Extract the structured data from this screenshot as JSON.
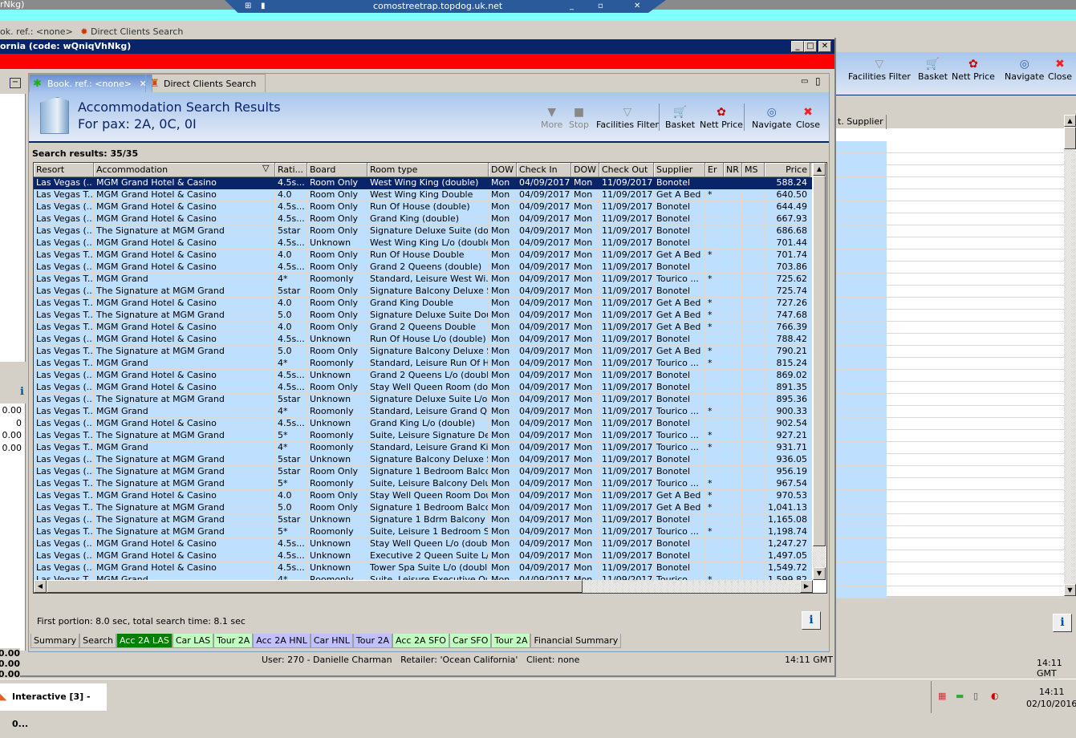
{
  "remote_bar": {
    "host": "comostreetrap.topdog.uk.net",
    "top_left_fragment": "rNkg)"
  },
  "bg_tabs": [
    "ok. ref.: <none>",
    "Direct Clients Search"
  ],
  "bg_toolbar": [
    "Facilities Filter",
    "Basket",
    "Nett Price",
    "Navigate",
    "Close"
  ],
  "bg_table": {
    "header": "t. Supplier",
    "time": "14:11 GMT"
  },
  "window": {
    "title": "ornia (code: wQniqVhNkg)"
  },
  "left_panel": {
    "values": [
      "0.00",
      "0",
      "0.00",
      "0.00"
    ],
    "bottom_values": [
      "0.00",
      "0.00",
      "0.00"
    ]
  },
  "tabs": [
    {
      "label": "Book. ref.: <none>"
    },
    {
      "label": "Direct Clients Search"
    }
  ],
  "header": {
    "title": "Accommodation Search Results",
    "subtitle": "For pax: 2A, 0C, 0I"
  },
  "toolbar": {
    "more": "More",
    "stop": "Stop",
    "facilities": "Facilities Filter",
    "basket": "Basket",
    "nett": "Nett Price",
    "navigate": "Navigate",
    "close": "Close"
  },
  "results_label": "Search results: 35/35",
  "columns": [
    "Resort",
    "Accommodation",
    "Rati...",
    "Board",
    "Room type",
    "DOW",
    "Check In",
    "DOW",
    "Check Out",
    "Supplier",
    "Er",
    "NR",
    "MS",
    "Price"
  ],
  "rows": [
    [
      "Las Vegas (...",
      "MGM Grand Hotel & Casino",
      "4.5s...",
      "Room Only",
      "West Wing King (double)",
      "Mon",
      "04/09/2017",
      "Mon",
      "11/09/2017",
      "Bonotel",
      "",
      "",
      "",
      "588.24"
    ],
    [
      "Las Vegas T...",
      "MGM Grand Hotel & Casino",
      "4.0",
      "Room Only",
      "West Wing King Double",
      "Mon",
      "04/09/2017",
      "Mon",
      "11/09/2017",
      "Get A Bed",
      "*",
      "",
      "",
      "640.50"
    ],
    [
      "Las Vegas (...",
      "MGM Grand Hotel & Casino",
      "4.5s...",
      "Room Only",
      "Run Of House (double)",
      "Mon",
      "04/09/2017",
      "Mon",
      "11/09/2017",
      "Bonotel",
      "",
      "",
      "",
      "644.49"
    ],
    [
      "Las Vegas (...",
      "MGM Grand Hotel & Casino",
      "4.5s...",
      "Room Only",
      "Grand King (double)",
      "Mon",
      "04/09/2017",
      "Mon",
      "11/09/2017",
      "Bonotel",
      "",
      "",
      "",
      "667.93"
    ],
    [
      "Las Vegas (...",
      "The Signature at MGM Grand",
      "5star",
      "Room Only",
      "Signature Deluxe Suite (do...",
      "Mon",
      "04/09/2017",
      "Mon",
      "11/09/2017",
      "Bonotel",
      "",
      "",
      "",
      "686.68"
    ],
    [
      "Las Vegas (...",
      "MGM Grand Hotel & Casino",
      "4.5s...",
      "Unknown",
      "West Wing King L/o (double)",
      "Mon",
      "04/09/2017",
      "Mon",
      "11/09/2017",
      "Bonotel",
      "",
      "",
      "",
      "701.44"
    ],
    [
      "Las Vegas T...",
      "MGM Grand Hotel & Casino",
      "4.0",
      "Room Only",
      "Run Of House Double",
      "Mon",
      "04/09/2017",
      "Mon",
      "11/09/2017",
      "Get A Bed",
      "*",
      "",
      "",
      "701.74"
    ],
    [
      "Las Vegas (...",
      "MGM Grand Hotel & Casino",
      "4.5s...",
      "Room Only",
      "Grand 2 Queens (double)",
      "Mon",
      "04/09/2017",
      "Mon",
      "11/09/2017",
      "Bonotel",
      "",
      "",
      "",
      "703.86"
    ],
    [
      "Las Vegas T...",
      "MGM Grand",
      "4*",
      "Roomonly",
      "Standard, Leisure West Wi...",
      "Mon",
      "04/09/2017",
      "Mon",
      "11/09/2017",
      "Tourico ...",
      "*",
      "",
      "",
      "725.62"
    ],
    [
      "Las Vegas (...",
      "The Signature at MGM Grand",
      "5star",
      "Room Only",
      "Signature Balcony Deluxe S...",
      "Mon",
      "04/09/2017",
      "Mon",
      "11/09/2017",
      "Bonotel",
      "",
      "",
      "",
      "725.74"
    ],
    [
      "Las Vegas T...",
      "MGM Grand Hotel & Casino",
      "4.0",
      "Room Only",
      "Grand King Double",
      "Mon",
      "04/09/2017",
      "Mon",
      "11/09/2017",
      "Get A Bed",
      "*",
      "",
      "",
      "727.26"
    ],
    [
      "Las Vegas T...",
      "The Signature at MGM Grand",
      "5.0",
      "Room Only",
      "Signature Deluxe Suite Double",
      "Mon",
      "04/09/2017",
      "Mon",
      "11/09/2017",
      "Get A Bed",
      "*",
      "",
      "",
      "747.68"
    ],
    [
      "Las Vegas T...",
      "MGM Grand Hotel & Casino",
      "4.0",
      "Room Only",
      "Grand 2 Queens Double",
      "Mon",
      "04/09/2017",
      "Mon",
      "11/09/2017",
      "Get A Bed",
      "*",
      "",
      "",
      "766.39"
    ],
    [
      "Las Vegas (...",
      "MGM Grand Hotel & Casino",
      "4.5s...",
      "Unknown",
      "Run Of House L/o (double)",
      "Mon",
      "04/09/2017",
      "Mon",
      "11/09/2017",
      "Bonotel",
      "",
      "",
      "",
      "788.42"
    ],
    [
      "Las Vegas T...",
      "The Signature at MGM Grand",
      "5.0",
      "Room Only",
      "Signature Balcony Deluxe S...",
      "Mon",
      "04/09/2017",
      "Mon",
      "11/09/2017",
      "Get A Bed",
      "*",
      "",
      "",
      "790.21"
    ],
    [
      "Las Vegas T...",
      "MGM Grand",
      "4*",
      "Roomonly",
      "Standard, Leisure Run Of H...",
      "Mon",
      "04/09/2017",
      "Mon",
      "11/09/2017",
      "Tourico ...",
      "*",
      "",
      "",
      "815.24"
    ],
    [
      "Las Vegas (...",
      "MGM Grand Hotel & Casino",
      "4.5s...",
      "Unknown",
      "Grand 2 Queens L/o (double)",
      "Mon",
      "04/09/2017",
      "Mon",
      "11/09/2017",
      "Bonotel",
      "",
      "",
      "",
      "869.02"
    ],
    [
      "Las Vegas (...",
      "MGM Grand Hotel & Casino",
      "4.5s...",
      "Room Only",
      "Stay Well Queen Room (do...",
      "Mon",
      "04/09/2017",
      "Mon",
      "11/09/2017",
      "Bonotel",
      "",
      "",
      "",
      "891.35"
    ],
    [
      "Las Vegas (...",
      "The Signature at MGM Grand",
      "5star",
      "Unknown",
      "Signature Deluxe Suite L/o ...",
      "Mon",
      "04/09/2017",
      "Mon",
      "11/09/2017",
      "Bonotel",
      "",
      "",
      "",
      "895.36"
    ],
    [
      "Las Vegas T...",
      "MGM Grand",
      "4*",
      "Roomonly",
      "Standard, Leisure Grand Q...",
      "Mon",
      "04/09/2017",
      "Mon",
      "11/09/2017",
      "Tourico ...",
      "*",
      "",
      "",
      "900.33"
    ],
    [
      "Las Vegas (...",
      "MGM Grand Hotel & Casino",
      "4.5s...",
      "Unknown",
      "Grand King L/o (double)",
      "Mon",
      "04/09/2017",
      "Mon",
      "11/09/2017",
      "Bonotel",
      "",
      "",
      "",
      "902.54"
    ],
    [
      "Las Vegas T...",
      "The Signature at MGM Grand",
      "5*",
      "Roomonly",
      "Suite, Leisure Signature Del...",
      "Mon",
      "04/09/2017",
      "Mon",
      "11/09/2017",
      "Tourico ...",
      "*",
      "",
      "",
      "927.21"
    ],
    [
      "Las Vegas T...",
      "MGM Grand",
      "4*",
      "Roomonly",
      "Standard, Leisure Grand King",
      "Mon",
      "04/09/2017",
      "Mon",
      "11/09/2017",
      "Tourico ...",
      "*",
      "",
      "",
      "931.71"
    ],
    [
      "Las Vegas (...",
      "The Signature at MGM Grand",
      "5star",
      "Unknown",
      "Signature Balcony Deluxe S...",
      "Mon",
      "04/09/2017",
      "Mon",
      "11/09/2017",
      "Bonotel",
      "",
      "",
      "",
      "936.05"
    ],
    [
      "Las Vegas (...",
      "The Signature at MGM Grand",
      "5star",
      "Room Only",
      "Signature 1 Bedroom Balco...",
      "Mon",
      "04/09/2017",
      "Mon",
      "11/09/2017",
      "Bonotel",
      "",
      "",
      "",
      "956.19"
    ],
    [
      "Las Vegas T...",
      "The Signature at MGM Grand",
      "5*",
      "Roomonly",
      "Suite, Leisure Balcony Delu...",
      "Mon",
      "04/09/2017",
      "Mon",
      "11/09/2017",
      "Tourico ...",
      "*",
      "",
      "",
      "967.54"
    ],
    [
      "Las Vegas T...",
      "MGM Grand Hotel & Casino",
      "4.0",
      "Room Only",
      "Stay Well Queen Room Dou...",
      "Mon",
      "04/09/2017",
      "Mon",
      "11/09/2017",
      "Get A Bed",
      "*",
      "",
      "",
      "970.53"
    ],
    [
      "Las Vegas T...",
      "The Signature at MGM Grand",
      "5.0",
      "Room Only",
      "Signature 1 Bedroom Balco...",
      "Mon",
      "04/09/2017",
      "Mon",
      "11/09/2017",
      "Get A Bed",
      "*",
      "",
      "",
      "1,041.13"
    ],
    [
      "Las Vegas (...",
      "The Signature at MGM Grand",
      "5star",
      "Unknown",
      "Signature 1 Bdrm Balcony S...",
      "Mon",
      "04/09/2017",
      "Mon",
      "11/09/2017",
      "Bonotel",
      "",
      "",
      "",
      "1,165.08"
    ],
    [
      "Las Vegas T...",
      "The Signature at MGM Grand",
      "5*",
      "Roomonly",
      "Suite, Leisure 1 Bedroom S...",
      "Mon",
      "04/09/2017",
      "Mon",
      "11/09/2017",
      "Tourico ...",
      "*",
      "",
      "",
      "1,198.74"
    ],
    [
      "Las Vegas (...",
      "MGM Grand Hotel & Casino",
      "4.5s...",
      "Unknown",
      "Stay Well Queen L/o (double)",
      "Mon",
      "04/09/2017",
      "Mon",
      "11/09/2017",
      "Bonotel",
      "",
      "",
      "",
      "1,247.27"
    ],
    [
      "Las Vegas (...",
      "MGM Grand Hotel & Casino",
      "4.5s...",
      "Unknown",
      "Executive 2 Queen Suite L/...",
      "Mon",
      "04/09/2017",
      "Mon",
      "11/09/2017",
      "Bonotel",
      "",
      "",
      "",
      "1,497.05"
    ],
    [
      "Las Vegas (...",
      "MGM Grand Hotel & Casino",
      "4.5s...",
      "Unknown",
      "Tower Spa Suite L/o (double)",
      "Mon",
      "04/09/2017",
      "Mon",
      "11/09/2017",
      "Bonotel",
      "",
      "",
      "",
      "1,549.72"
    ],
    [
      "Las Vegas T...",
      "MGM Grand",
      "4*",
      "Roomonly",
      "Suite, Leisure Executive Qu...",
      "Mon",
      "04/09/2017",
      "Mon",
      "11/09/2017",
      "Tourico ...",
      "*",
      "",
      "",
      "1,599.82"
    ]
  ],
  "selected_row": 0,
  "status": "First portion: 8.0 sec, total search time: 8.1 sec",
  "info_label": "i",
  "bottom_tabs": [
    {
      "label": "Summary",
      "color": "#d4d0c8",
      "text": "#000"
    },
    {
      "label": "Search",
      "color": "#d4d0c8",
      "text": "#000"
    },
    {
      "label": "Acc 2A LAS",
      "color": "#008000",
      "text": "#ffffff"
    },
    {
      "label": "Car LAS",
      "color": "#c0ffc0",
      "text": "#000"
    },
    {
      "label": "Tour 2A",
      "color": "#c0ffc0",
      "text": "#000"
    },
    {
      "label": "Acc 2A HNL",
      "color": "#c0c0ff",
      "text": "#000"
    },
    {
      "label": "Car HNL",
      "color": "#c0c0ff",
      "text": "#000"
    },
    {
      "label": "Tour 2A",
      "color": "#c0c0ff",
      "text": "#000"
    },
    {
      "label": "Acc 2A SFO",
      "color": "#c0ffc0",
      "text": "#000"
    },
    {
      "label": "Car SFO",
      "color": "#c0ffc0",
      "text": "#000"
    },
    {
      "label": "Tour 2A",
      "color": "#c0ffc0",
      "text": "#000"
    },
    {
      "label": "Financial Summary",
      "color": "#d4d0c8",
      "text": "#000"
    }
  ],
  "statusbar": {
    "user": "User: 270 - Danielle Charman",
    "retailer": "Retailer: 'Ocean California'",
    "client": "Client: none",
    "time": "14:11 GMT"
  },
  "taskbar": {
    "app": "Interactive [3] - 0...",
    "clock_time": "14:11",
    "clock_date": "02/10/2016"
  }
}
